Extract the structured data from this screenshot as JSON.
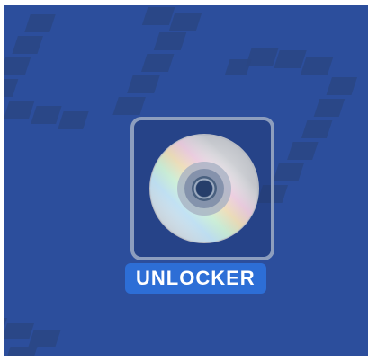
{
  "desktop": {
    "icon": {
      "name": "dvd-disc-icon",
      "label": "UNLOCKER",
      "selected": true
    },
    "colors": {
      "background": "#2c4e9c",
      "label_highlight": "#2d6ed6"
    }
  }
}
